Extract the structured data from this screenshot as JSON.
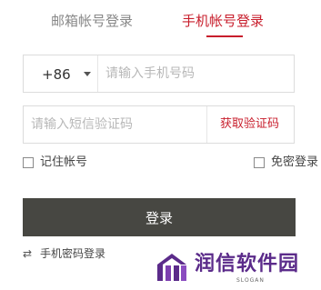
{
  "tabs": {
    "email_label": "邮箱帐号登录",
    "phone_label": "手机帐号登录",
    "active": "手机帐号登录"
  },
  "phone": {
    "country_code": "+86",
    "placeholder": "请输入手机号码",
    "value": ""
  },
  "sms": {
    "placeholder": "请输入短信验证码",
    "value": "",
    "get_code_label": "获取验证码"
  },
  "options": {
    "remember_label": "记住帐号",
    "remember_checked": false,
    "auto_login_label": "免密登录",
    "auto_login_checked": false
  },
  "login_button_label": "登录",
  "switch_link": {
    "icon": "swap-arrows-icon",
    "label": "手机密码登录"
  },
  "watermark": {
    "title": "润信软件园",
    "slogan": "SLOGAN"
  },
  "colors": {
    "accent_red": "#c81e2c",
    "button_dark": "#474742",
    "watermark_purple": "#5b2b8a"
  }
}
